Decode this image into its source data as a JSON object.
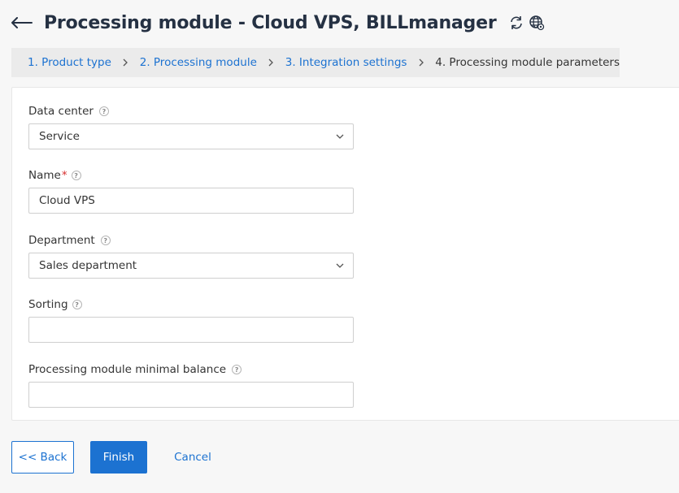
{
  "header": {
    "title": "Processing module - Cloud VPS, BILLmanager"
  },
  "steps": [
    {
      "label": "1. Product type"
    },
    {
      "label": "2. Processing module"
    },
    {
      "label": "3. Integration settings"
    },
    {
      "label": "4. Processing module parameters"
    }
  ],
  "form": {
    "data_center": {
      "label": "Data center",
      "value": "Service"
    },
    "name": {
      "label": "Name",
      "required_mark": "*",
      "value": "Cloud VPS"
    },
    "department": {
      "label": "Department",
      "value": "Sales department"
    },
    "sorting": {
      "label": "Sorting",
      "value": ""
    },
    "min_balance": {
      "label": "Processing module minimal balance",
      "value": ""
    },
    "help_glyph": "?"
  },
  "buttons": {
    "back": "<< Back",
    "finish": "Finish",
    "cancel": "Cancel"
  },
  "colors": {
    "accent": "#1c72d1",
    "title": "#253143",
    "required": "#d62d2d"
  }
}
